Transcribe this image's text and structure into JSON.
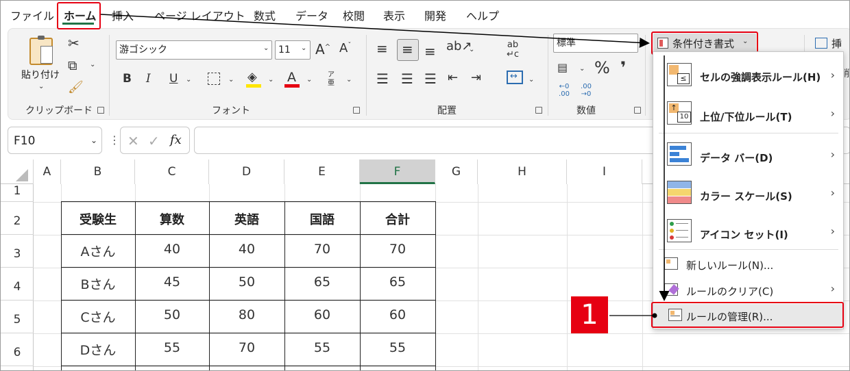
{
  "menu_tabs": [
    "ファイル",
    "ホーム",
    "挿入",
    "ページ レイアウト",
    "数式",
    "データ",
    "校閲",
    "表示",
    "開発",
    "ヘルプ"
  ],
  "ribbon": {
    "clipboard": {
      "paste_label": "貼り付け",
      "group_label": "クリップボード"
    },
    "font": {
      "font_name": "游ゴシック",
      "font_size": "11",
      "bold": "B",
      "italic": "I",
      "underline": "U",
      "font_color": "A",
      "furigana": "ア亜",
      "group_label": "フォント"
    },
    "alignment": {
      "group_label": "配置"
    },
    "number": {
      "format": "標準",
      "percent": "%",
      "comma": "❜",
      "inc": "←0 .00",
      "dec": ".00 →0",
      "group_label": "数値"
    },
    "styles": {
      "conditional_format_label": "条件付き書式"
    },
    "cells": {
      "insert_label": "挿入"
    }
  },
  "formula_bar": {
    "name_box": "F10",
    "fx": "fx",
    "value": ""
  },
  "columns": [
    "A",
    "B",
    "C",
    "D",
    "E",
    "F",
    "G",
    "H",
    "I"
  ],
  "rows": [
    "1",
    "2",
    "3",
    "4",
    "5",
    "6"
  ],
  "table": {
    "headers": [
      "受験生",
      "算数",
      "英語",
      "国語",
      "合計"
    ],
    "rows": [
      [
        "Aさん",
        "40",
        "40",
        "70",
        "70"
      ],
      [
        "Bさん",
        "45",
        "50",
        "65",
        "65"
      ],
      [
        "Cさん",
        "50",
        "80",
        "60",
        "60"
      ],
      [
        "Dさん",
        "55",
        "70",
        "55",
        "55"
      ]
    ]
  },
  "dropdown": {
    "items": [
      {
        "label": "セルの強調表示ルール(H)",
        "icon": "highlight-rules-icon"
      },
      {
        "label": "上位/下位ルール(T)",
        "icon": "top-bottom-icon"
      },
      {
        "label": "データ バー(D)",
        "icon": "data-bar-icon"
      },
      {
        "label": "カラー スケール(S)",
        "icon": "color-scale-icon"
      },
      {
        "label": "アイコン セット(I)",
        "icon": "icon-set-icon"
      }
    ],
    "small_items": [
      {
        "label": "新しいルール(N)...",
        "icon": "new-rule-icon"
      },
      {
        "label": "ルールのクリア(C)",
        "icon": "clear-rules-icon"
      },
      {
        "label": "ルールの管理(R)...",
        "icon": "manage-rules-icon"
      }
    ]
  },
  "callout": {
    "number": "1"
  },
  "colors": {
    "highlight_red": "#e60012",
    "accent_green": "#217346",
    "selected_col": "#d2d2d2"
  }
}
